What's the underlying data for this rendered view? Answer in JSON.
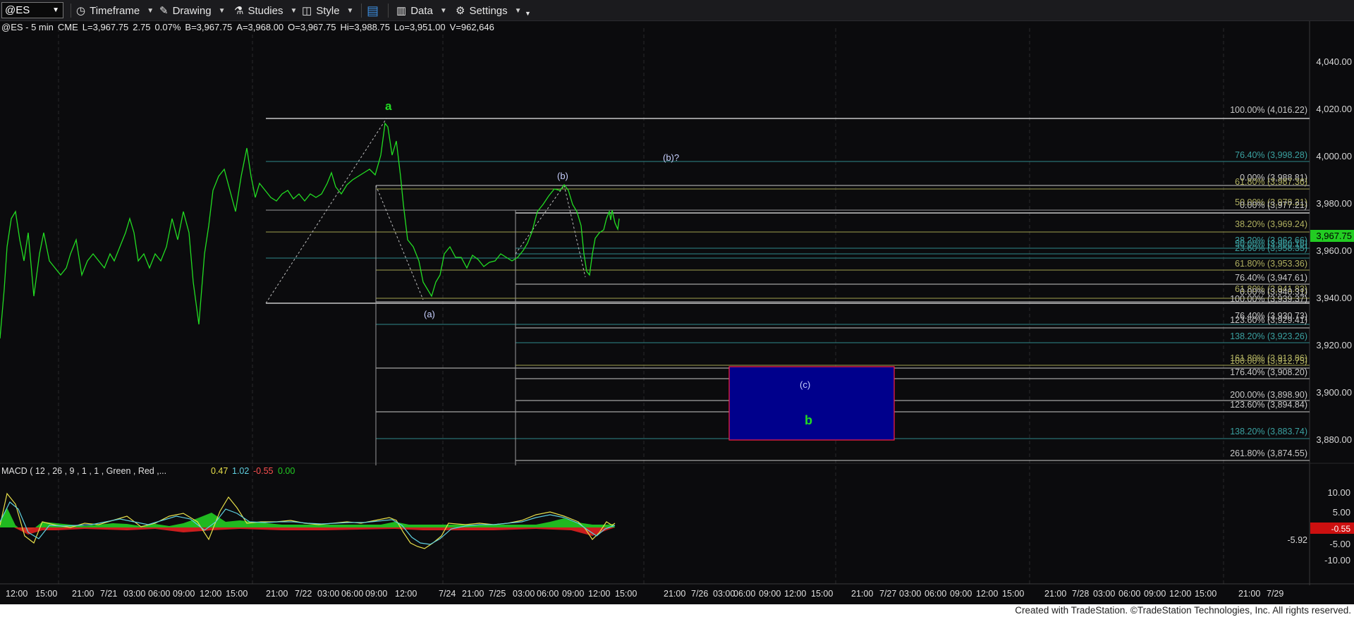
{
  "toolbar": {
    "symbol": "@ES",
    "timeframe_label": "Timeframe",
    "drawing_label": "Drawing",
    "studies_label": "Studies",
    "style_label": "Style",
    "data_label": "Data",
    "settings_label": "Settings"
  },
  "quote": {
    "symbol_desc": "@ES - 5 min",
    "exchange": "CME",
    "last": "L=3,967.75",
    "change": "2.75",
    "change_pct": "0.07%",
    "bid": "B=3,967.75",
    "ask": "A=3,968.00",
    "open": "O=3,967.75",
    "high": "Hi=3,988.75",
    "low": "Lo=3,951.00",
    "volume": "V=962,646"
  },
  "price_axis": [
    "4,040.00",
    "4,020.00",
    "4,000.00",
    "3,980.00",
    "3,960.00",
    "3,940.00",
    "3,920.00",
    "3,900.00",
    "3,880.00"
  ],
  "last_price_tag": "3,967.75",
  "time_axis": [
    "12:00",
    "15:00",
    "21:00",
    "7/21",
    "03:00",
    "06:00",
    "09:00",
    "12:00",
    "15:00",
    "21:00",
    "7/22",
    "03:00",
    "06:00",
    "09:00",
    "12:00",
    "7/24",
    "21:00",
    "7/25",
    "03:00",
    "06:00",
    "09:00",
    "12:00",
    "15:00",
    "21:00",
    "7/26",
    "03:00",
    "06:00",
    "09:00",
    "12:00",
    "15:00",
    "21:00",
    "7/27",
    "03:00",
    "06:00",
    "09:00",
    "12:00",
    "15:00",
    "21:00",
    "7/28",
    "03:00",
    "06:00",
    "09:00",
    "12:00",
    "15:00",
    "21:00",
    "7/29"
  ],
  "fib_labels": [
    {
      "text": "100.00% (4,016.22)",
      "color": "#c8c8c8"
    },
    {
      "text": "76.40% (3,998.28)",
      "color": "#3aa0a0"
    },
    {
      "text": "0.00% (3,988.81)",
      "color": "#c8c8c8"
    },
    {
      "text": "61.80% (3,987.36)",
      "color": "#b0b060"
    },
    {
      "text": "50.00% (3,978.21)",
      "color": "#b0b060"
    },
    {
      "text": "0.00% (3,977.21)",
      "color": "#c8c8c8"
    },
    {
      "text": "38.20% (3,969.24)",
      "color": "#b0b060"
    },
    {
      "text": "38.20% (3,962.66)",
      "color": "#3aa0a0"
    },
    {
      "text": "50.00% (3,960.16)",
      "color": "#3aa0a0"
    },
    {
      "text": "23.60% (3,958.35)",
      "color": "#3aa0a0"
    },
    {
      "text": "61.80% (3,953.36)",
      "color": "#b0b060"
    },
    {
      "text": "76.40% (3,947.61)",
      "color": "#c8c8c8"
    },
    {
      "text": "61.80% (3,941.83)",
      "color": "#b0b060"
    },
    {
      "text": "0.00% (3,940.31)",
      "color": "#c8c8c8"
    },
    {
      "text": "100.00% (3,939.37)",
      "color": "#c8c8c8"
    },
    {
      "text": "76.40% (3,930.73)",
      "color": "#c8c8c8"
    },
    {
      "text": "123.60% (3,929.41)",
      "color": "#c8c8c8"
    },
    {
      "text": "138.20% (3,923.26)",
      "color": "#3aa0a0"
    },
    {
      "text": "161.80% (3,913.86)",
      "color": "#b0b060"
    },
    {
      "text": "100.00% (3,912.75)",
      "color": "#b0b060"
    },
    {
      "text": "176.40% (3,908.20)",
      "color": "#c8c8c8"
    },
    {
      "text": "200.00% (3,898.90)",
      "color": "#c8c8c8"
    },
    {
      "text": "123.60% (3,894.84)",
      "color": "#c8c8c8"
    },
    {
      "text": "138.20% (3,883.74)",
      "color": "#3aa0a0"
    },
    {
      "text": "261.80% (3,874.55)",
      "color": "#c8c8c8"
    }
  ],
  "wave_labels": {
    "a": "a",
    "paren_a": "(a)",
    "paren_b": "(b)",
    "paren_b_q": "(b)?",
    "paren_c": "(c)",
    "b": "b"
  },
  "macd": {
    "title": "MACD ( 12 , 26 , 9 , 1 , 1 , Green , Red ,...",
    "v1": "0.47",
    "v2": "1.02",
    "v3": "-0.55",
    "v4": "0.00",
    "axis": [
      "10.00",
      "5.00",
      "-5.00",
      "-10.00"
    ],
    "tag_red": "-0.55",
    "tag_min": "-5.92"
  },
  "colors": {
    "price_green": "#22dd22",
    "macd_yellow": "#e8e04a",
    "macd_cyan": "#5fd0e0",
    "macd_neg": "#ff3030",
    "target_box": "#00008c",
    "target_border": "#ff2040"
  },
  "footer_text": "Created with TradeStation. ©TradeStation Technologies, Inc. All rights reserved."
}
